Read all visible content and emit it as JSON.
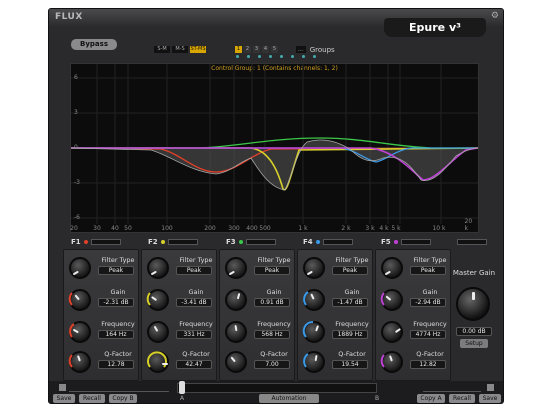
{
  "header": {
    "brand": "FLUX",
    "product": "Epure v³",
    "settings_icon": "gear-icon"
  },
  "toolbar": {
    "bypass": "Bypass",
    "band_state": [
      {
        "label": "S-M",
        "active": false
      },
      {
        "label": "M-S",
        "active": false
      },
      {
        "label": "ST-MS",
        "active": true
      }
    ],
    "groups": [
      "1",
      "2",
      "3",
      "4",
      "5"
    ],
    "group_more": "...",
    "group_dots": [
      "6",
      "7",
      "8",
      "9",
      "10",
      "11",
      "12",
      "13"
    ],
    "groups_label": "Groups"
  },
  "graph": {
    "control_group_text": "Control Group: 1 (Contains channels: 1, 2)",
    "y_ticks": [
      "6",
      "3",
      "0",
      "-3",
      "-6"
    ],
    "x_ticks": [
      "20",
      "30",
      "40",
      "50",
      "100",
      "200",
      "300",
      "400",
      "500",
      "1 k",
      "2 k",
      "3 k",
      "4 k",
      "5 k",
      "10 k",
      "20 k"
    ],
    "colors": {
      "f1": "#e0402a",
      "f2": "#d8d02a",
      "f3": "#3cc84a",
      "f4": "#3a9ae8",
      "f5": "#c040d8",
      "sum": "#bbbbbb"
    }
  },
  "bands": [
    {
      "name": "F1",
      "color": "#e0402a",
      "filter_type_label": "Filter Type",
      "filter_type": "Peak",
      "gain_label": "Gain",
      "gain": "-2.31 dB",
      "freq_label": "Frequency",
      "freq": "164 Hz",
      "q_label": "Q-Factor",
      "q": "12.78"
    },
    {
      "name": "F2",
      "color": "#d8d02a",
      "filter_type_label": "Filter Type",
      "filter_type": "Peak",
      "gain_label": "Gain",
      "gain": "-3.41 dB",
      "freq_label": "Frequency",
      "freq": "331 Hz",
      "q_label": "Q-Factor",
      "q": "42.47"
    },
    {
      "name": "F3",
      "color": "#3cc84a",
      "filter_type_label": "Filter Type",
      "filter_type": "Peak",
      "gain_label": "Gain",
      "gain": "0.91 dB",
      "freq_label": "Frequency",
      "freq": "568 Hz",
      "q_label": "Q-Factor",
      "q": "7.00"
    },
    {
      "name": "F4",
      "color": "#3a9ae8",
      "filter_type_label": "Filter Type",
      "filter_type": "Peak",
      "gain_label": "Gain",
      "gain": "-1.47 dB",
      "freq_label": "Frequency",
      "freq": "1889 Hz",
      "q_label": "Q-Factor",
      "q": "19.54"
    },
    {
      "name": "F5",
      "color": "#c040d8",
      "filter_type_label": "Filter Type",
      "filter_type": "Peak",
      "gain_label": "Gain",
      "gain": "-2.94 dB",
      "freq_label": "Frequency",
      "freq": "4774 Hz",
      "q_label": "Q-Factor",
      "q": "12.82"
    }
  ],
  "master": {
    "label": "Master Gain",
    "value": "0.00 dB",
    "setup": "Setup"
  },
  "bottom": {
    "preset_left": "---",
    "preset_right": "---",
    "automation": "Automation",
    "a": "A",
    "b": "B",
    "save": "Save",
    "recall": "Recall",
    "copy_b": "Copy B",
    "copy_a": "Copy A"
  }
}
